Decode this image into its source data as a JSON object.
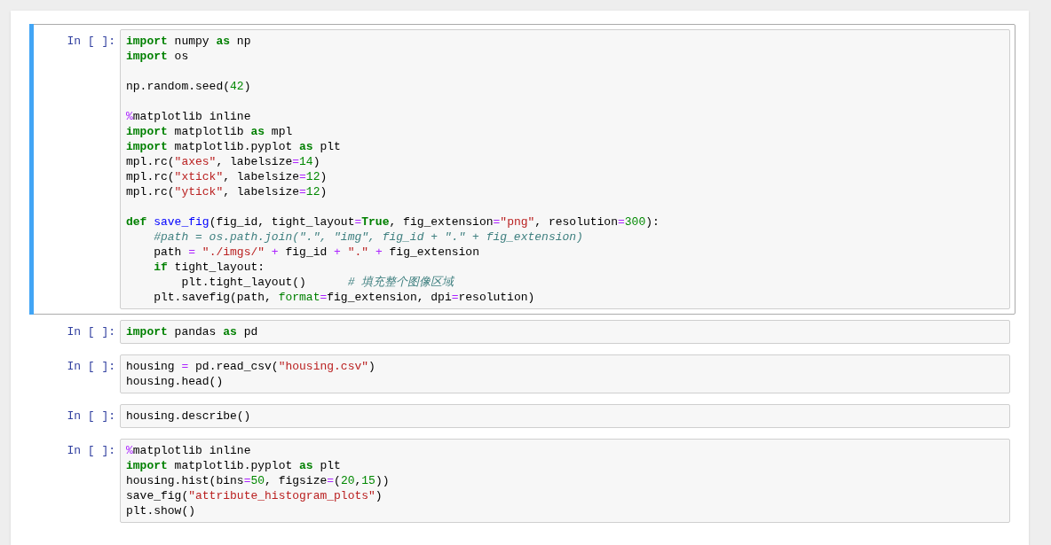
{
  "cells": [
    {
      "prompt": "In [ ]:",
      "selected": true,
      "blocks": [
        [
          [
            {
              "kind": "keyword",
              "text": "import"
            },
            {
              "kind": "plain",
              "text": " numpy "
            },
            {
              "kind": "keyword",
              "text": "as"
            },
            {
              "kind": "plain",
              "text": " np"
            }
          ],
          [
            {
              "kind": "keyword",
              "text": "import"
            },
            {
              "kind": "plain",
              "text": " os"
            }
          ]
        ],
        [
          [
            {
              "kind": "plain",
              "text": "np.random.seed("
            },
            {
              "kind": "number",
              "text": "42"
            },
            {
              "kind": "plain",
              "text": ")"
            }
          ]
        ],
        [
          [
            {
              "kind": "operator",
              "text": "%"
            },
            {
              "kind": "plain",
              "text": "matplotlib inline"
            }
          ],
          [
            {
              "kind": "keyword",
              "text": "import"
            },
            {
              "kind": "plain",
              "text": " matplotlib "
            },
            {
              "kind": "keyword",
              "text": "as"
            },
            {
              "kind": "plain",
              "text": " mpl"
            }
          ],
          [
            {
              "kind": "keyword",
              "text": "import"
            },
            {
              "kind": "plain",
              "text": " matplotlib.pyplot "
            },
            {
              "kind": "keyword",
              "text": "as"
            },
            {
              "kind": "plain",
              "text": " plt"
            }
          ],
          [
            {
              "kind": "plain",
              "text": "mpl.rc("
            },
            {
              "kind": "string",
              "text": "\"axes\""
            },
            {
              "kind": "plain",
              "text": ", labelsize"
            },
            {
              "kind": "operator",
              "text": "="
            },
            {
              "kind": "number",
              "text": "14"
            },
            {
              "kind": "plain",
              "text": ")"
            }
          ],
          [
            {
              "kind": "plain",
              "text": "mpl.rc("
            },
            {
              "kind": "string",
              "text": "\"xtick\""
            },
            {
              "kind": "plain",
              "text": ", labelsize"
            },
            {
              "kind": "operator",
              "text": "="
            },
            {
              "kind": "number",
              "text": "12"
            },
            {
              "kind": "plain",
              "text": ")"
            }
          ],
          [
            {
              "kind": "plain",
              "text": "mpl.rc("
            },
            {
              "kind": "string",
              "text": "\"ytick\""
            },
            {
              "kind": "plain",
              "text": ", labelsize"
            },
            {
              "kind": "operator",
              "text": "="
            },
            {
              "kind": "number",
              "text": "12"
            },
            {
              "kind": "plain",
              "text": ")"
            }
          ]
        ],
        [
          [
            {
              "kind": "keyword",
              "text": "def"
            },
            {
              "kind": "function",
              "text": " save_fig"
            },
            {
              "kind": "plain",
              "text": "(fig_id, tight_layout"
            },
            {
              "kind": "operator",
              "text": "="
            },
            {
              "kind": "keyword",
              "text": "True"
            },
            {
              "kind": "plain",
              "text": ", fig_extension"
            },
            {
              "kind": "operator",
              "text": "="
            },
            {
              "kind": "string",
              "text": "\"png\""
            },
            {
              "kind": "plain",
              "text": ", resolution"
            },
            {
              "kind": "operator",
              "text": "="
            },
            {
              "kind": "number",
              "text": "300"
            },
            {
              "kind": "plain",
              "text": "):"
            }
          ],
          [
            {
              "kind": "comment",
              "text": "    #path = os.path.join(\".\", \"img\", fig_id + \".\" + fig_extension)"
            }
          ],
          [
            {
              "kind": "plain",
              "text": "    path "
            },
            {
              "kind": "operator",
              "text": "="
            },
            {
              "kind": "string",
              "text": " \"./imgs/\" "
            },
            {
              "kind": "operator",
              "text": "+"
            },
            {
              "kind": "plain",
              "text": " fig_id "
            },
            {
              "kind": "operator",
              "text": "+"
            },
            {
              "kind": "string",
              "text": " \".\" "
            },
            {
              "kind": "operator",
              "text": "+"
            },
            {
              "kind": "plain",
              "text": " fig_extension"
            }
          ],
          [
            {
              "kind": "keyword",
              "text": "    if"
            },
            {
              "kind": "plain",
              "text": " tight_layout:"
            }
          ],
          [
            {
              "kind": "plain",
              "text": "        plt.tight_layout()      "
            },
            {
              "kind": "comment",
              "text": "# 填充整个图像区域"
            }
          ],
          [
            {
              "kind": "plain",
              "text": "    plt.savefig(path, "
            },
            {
              "kind": "argument",
              "text": "format"
            },
            {
              "kind": "operator",
              "text": "="
            },
            {
              "kind": "plain",
              "text": "fig_extension, dpi"
            },
            {
              "kind": "operator",
              "text": "="
            },
            {
              "kind": "plain",
              "text": "resolution)"
            }
          ]
        ]
      ]
    },
    {
      "prompt": "In [ ]:",
      "selected": false,
      "blocks": [
        [
          [
            {
              "kind": "keyword",
              "text": "import"
            },
            {
              "kind": "plain",
              "text": " pandas "
            },
            {
              "kind": "keyword",
              "text": "as"
            },
            {
              "kind": "plain",
              "text": " pd"
            }
          ]
        ]
      ]
    },
    {
      "prompt": "In [ ]:",
      "selected": false,
      "blocks": [
        [
          [
            {
              "kind": "plain",
              "text": "housing "
            },
            {
              "kind": "operator",
              "text": "="
            },
            {
              "kind": "plain",
              "text": " pd.read_csv("
            },
            {
              "kind": "string",
              "text": "\"housing.csv\""
            },
            {
              "kind": "plain",
              "text": ")"
            }
          ],
          [
            {
              "kind": "plain",
              "text": "housing.head()"
            }
          ]
        ]
      ]
    },
    {
      "prompt": "In [ ]:",
      "selected": false,
      "blocks": [
        [
          [
            {
              "kind": "plain",
              "text": "housing.describe()"
            }
          ]
        ]
      ]
    },
    {
      "prompt": "In [ ]:",
      "selected": false,
      "blocks": [
        [
          [
            {
              "kind": "operator",
              "text": "%"
            },
            {
              "kind": "plain",
              "text": "matplotlib inline"
            }
          ],
          [
            {
              "kind": "keyword",
              "text": "import"
            },
            {
              "kind": "plain",
              "text": " matplotlib.pyplot "
            },
            {
              "kind": "keyword",
              "text": "as"
            },
            {
              "kind": "plain",
              "text": " plt"
            }
          ],
          [
            {
              "kind": "plain",
              "text": "housing.hist(bins"
            },
            {
              "kind": "operator",
              "text": "="
            },
            {
              "kind": "number",
              "text": "50"
            },
            {
              "kind": "plain",
              "text": ", figsize"
            },
            {
              "kind": "operator",
              "text": "="
            },
            {
              "kind": "plain",
              "text": "("
            },
            {
              "kind": "number",
              "text": "20"
            },
            {
              "kind": "plain",
              "text": ","
            },
            {
              "kind": "number",
              "text": "15"
            },
            {
              "kind": "plain",
              "text": "))"
            }
          ],
          [
            {
              "kind": "plain",
              "text": "save_fig("
            },
            {
              "kind": "string",
              "text": "\"attribute_histogram_plots\""
            },
            {
              "kind": "plain",
              "text": ")"
            }
          ],
          [
            {
              "kind": "plain",
              "text": "plt.show()"
            }
          ]
        ]
      ]
    }
  ]
}
